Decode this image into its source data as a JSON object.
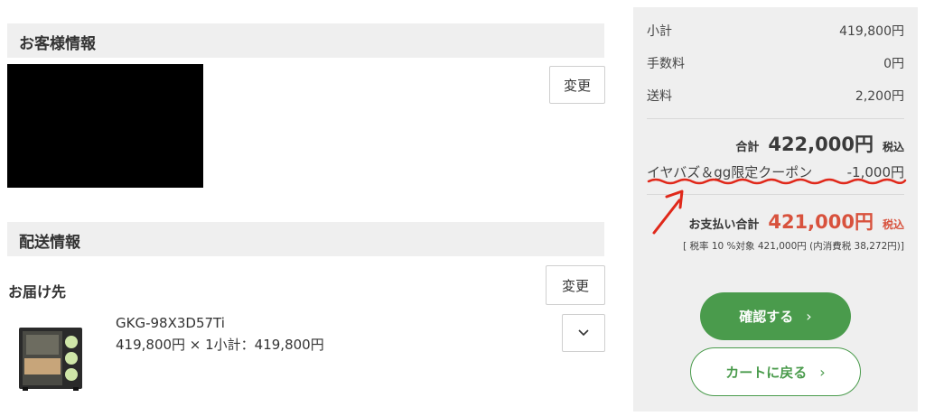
{
  "customer_section": {
    "title": "お客様情報",
    "change_label": "変更"
  },
  "shipping_section": {
    "title": "配送情報",
    "destination_label": "お届け先",
    "change_label": "変更",
    "product": {
      "name": "GKG-98X3D57Ti",
      "price_line": "419,800円 × 1小計：419,800円"
    }
  },
  "summary": {
    "subtotal": {
      "label": "小計",
      "value": "419,800円"
    },
    "fee": {
      "label": "手数料",
      "value": "0円"
    },
    "shipping": {
      "label": "送料",
      "value": "2,200円"
    },
    "total": {
      "label": "合計",
      "value": "422,000円",
      "tax": "税込"
    },
    "coupon": {
      "label": "イヤバズ＆gg限定クーポン",
      "value": "-1,000円"
    },
    "payment": {
      "label": "お支払い合計",
      "value": "421,000円",
      "tax": "税込"
    },
    "tax_note": "[ 税率 10 %対象  421,000円 (内消費税 38,272円)]",
    "confirm_label": "確認する",
    "back_label": "カートに戻る"
  },
  "colors": {
    "accent_green": "#4a9b4c",
    "payment_red": "#d8523d",
    "annotation_red": "#e0281a",
    "panel_gray": "#efefef"
  },
  "icons": {
    "chevron_right": "chevron-right-icon",
    "chevron_down": "chevron-down-icon"
  }
}
